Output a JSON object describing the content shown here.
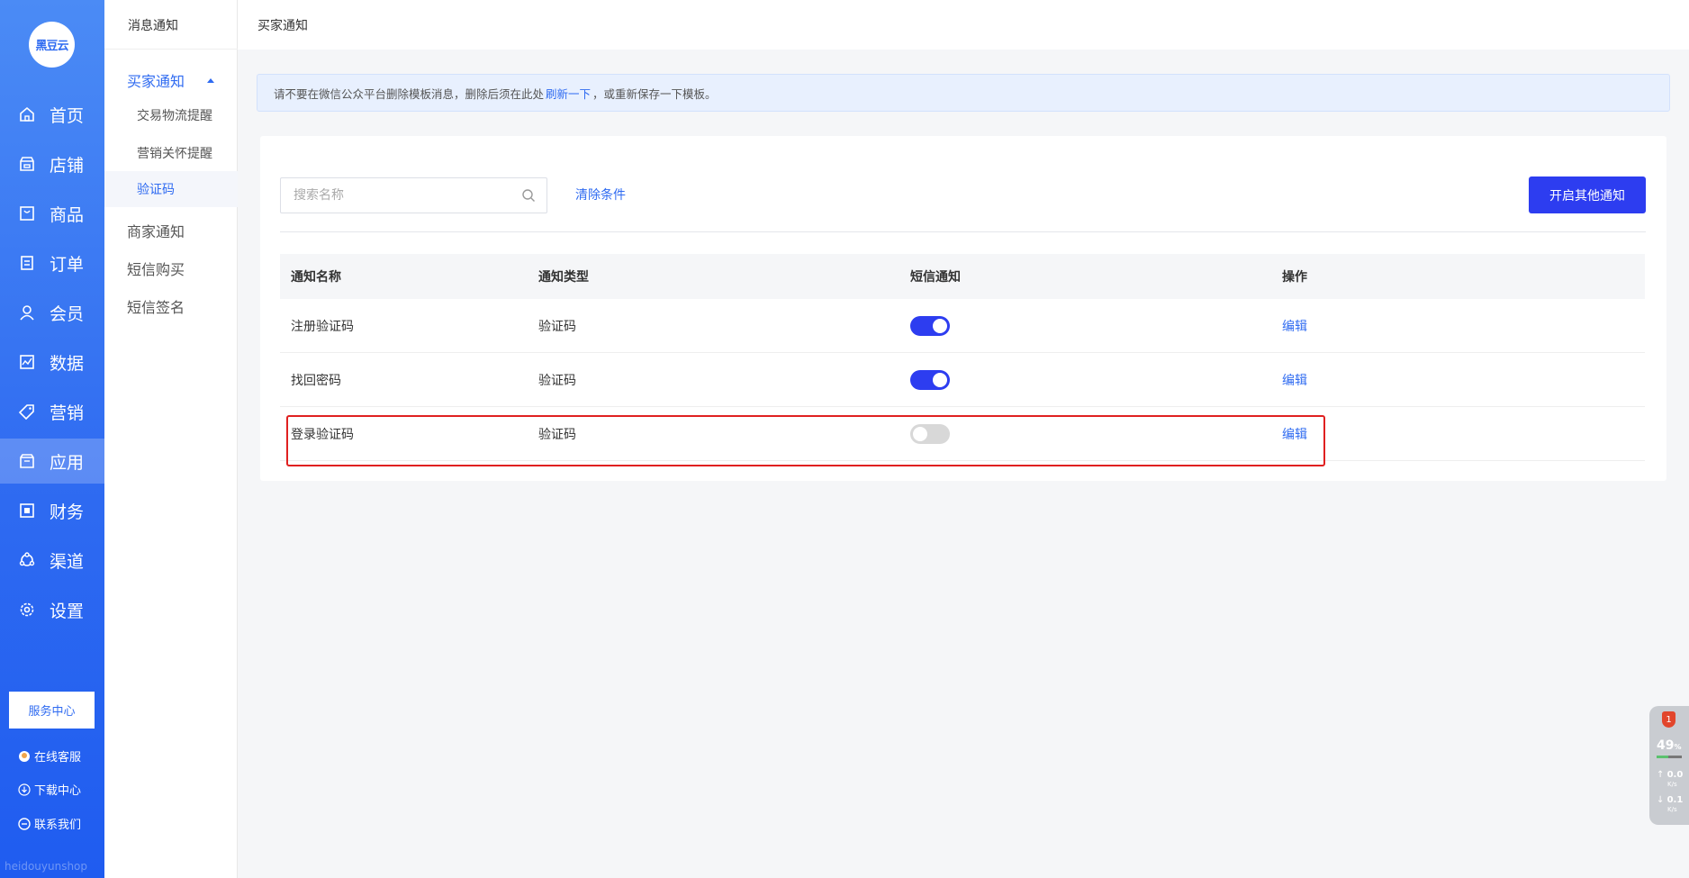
{
  "sidebar": {
    "logo_text": "黑豆云",
    "items": [
      {
        "label": "首页",
        "icon": "home-icon"
      },
      {
        "label": "店铺",
        "icon": "store-icon"
      },
      {
        "label": "商品",
        "icon": "goods-icon"
      },
      {
        "label": "订单",
        "icon": "order-icon"
      },
      {
        "label": "会员",
        "icon": "member-icon"
      },
      {
        "label": "数据",
        "icon": "data-icon"
      },
      {
        "label": "营销",
        "icon": "marketing-tag-icon"
      },
      {
        "label": "应用",
        "icon": "app-icon",
        "active": true
      },
      {
        "label": "财务",
        "icon": "finance-icon"
      },
      {
        "label": "渠道",
        "icon": "channel-icon"
      },
      {
        "label": "设置",
        "icon": "settings-icon"
      }
    ],
    "service_center": "服务中心",
    "links": {
      "online_service": "在线客服",
      "download_center": "下载中心",
      "contact_us": "联系我们"
    },
    "watermark": "heidouyunshop"
  },
  "submenu": {
    "title": "消息通知",
    "buyer_group": "买家通知",
    "buyer_children": [
      "交易物流提醒",
      "营销关怀提醒",
      "验证码"
    ],
    "merchant": "商家通知",
    "sms_purchase": "短信购买",
    "sms_signature": "短信签名"
  },
  "header": {
    "breadcrumb": "买家通知"
  },
  "notice": {
    "before": "请不要在微信公众平台删除模板消息，删除后须在此处",
    "link": "刷新一下",
    "after": "，或重新保存一下模板。"
  },
  "toolbar": {
    "search_placeholder": "搜索名称",
    "clear_label": "清除条件",
    "primary_label": "开启其他通知"
  },
  "table": {
    "headers": [
      "通知名称",
      "通知类型",
      "短信通知",
      "操作"
    ],
    "rows": [
      {
        "name": "注册验证码",
        "type": "验证码",
        "sms_on": true,
        "action": "编辑"
      },
      {
        "name": "找回密码",
        "type": "验证码",
        "sms_on": true,
        "action": "编辑"
      },
      {
        "name": "登录验证码",
        "type": "验证码",
        "sms_on": false,
        "action": "编辑"
      }
    ]
  },
  "widget": {
    "badge": "1",
    "percent": "49",
    "percent_unit": "%",
    "up_speed": "0.0",
    "down_speed": "0.1",
    "speed_unit": "K/s"
  },
  "colors": {
    "brand": "#2f6bf1",
    "primary_button": "#2d3df0",
    "highlight": "#e02020"
  }
}
